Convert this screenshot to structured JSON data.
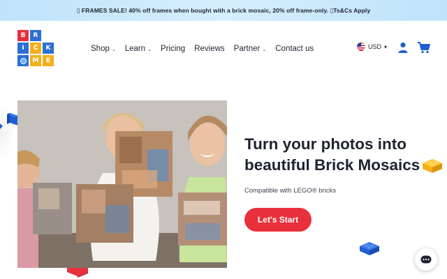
{
  "announcement": "▯ FRAMES SALE! 40% off frames when bought with a brick mosaic, 20% off frame-only. ▯Ts&Cs Apply",
  "logo": {
    "tiles": [
      {
        "letter": "B",
        "color": "#e8303c"
      },
      {
        "letter": "R",
        "color": "#2b6fd6"
      },
      {
        "letter": "",
        "color": "#ffffff"
      },
      {
        "letter": "I",
        "color": "#2b6fd6"
      },
      {
        "letter": "C",
        "color": "#f2b11c"
      },
      {
        "letter": "K",
        "color": "#2b6fd6"
      },
      {
        "letter": "",
        "color": "#2b6fd6"
      },
      {
        "letter": "M",
        "color": "#f2b11c"
      },
      {
        "letter": "E",
        "color": "#f2b11c"
      }
    ]
  },
  "nav": {
    "shop": "Shop",
    "learn": "Learn",
    "pricing": "Pricing",
    "reviews": "Reviews",
    "partner": "Partner",
    "contact": "Contact us"
  },
  "currency": "USD",
  "hero": {
    "title_line1": "Turn your photos into",
    "title_line2": "beautiful Brick Mosaics",
    "subtitle": "Compatible with LEGO® bricks",
    "cta": "Let's Start"
  },
  "colors": {
    "accent_red": "#e8303c",
    "brand_blue": "#1f5fd1",
    "brick_yellow": "#f2b11c",
    "announce_bg": "#cfe9fb"
  },
  "icons": {
    "account": "account-icon",
    "cart": "cart-icon",
    "chat": "chat-icon"
  }
}
